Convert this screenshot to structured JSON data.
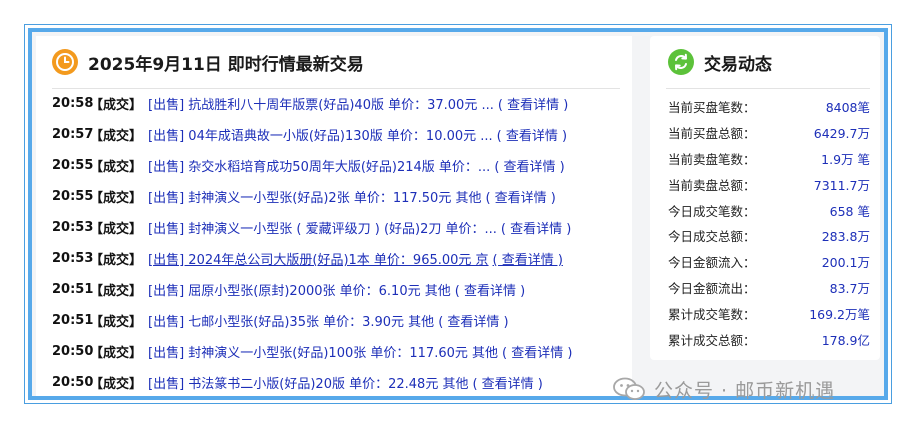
{
  "left_panel": {
    "title": "2025年9月11日 即时行情最新交易",
    "trades": [
      {
        "time": "20:58",
        "status": "【成交】",
        "desc": "[出售] 抗战胜利八十周年版票(好品)40版 单价：37.00元 ...",
        "detail": "( 查看详情 )"
      },
      {
        "time": "20:57",
        "status": "【成交】",
        "desc": "[出售] 04年成语典故一小版(好品)130版 单价：10.00元 ...",
        "detail": "( 查看详情 )"
      },
      {
        "time": "20:55",
        "status": "【成交】",
        "desc": "[出售] 杂交水稻培育成功50周年大版(好品)214版 单价：...",
        "detail": "( 查看详情 )"
      },
      {
        "time": "20:55",
        "status": "【成交】",
        "desc": "[出售] 封神演义一小型张(好品)2张 单价：117.50元 其他",
        "detail": "( 查看详情 )"
      },
      {
        "time": "20:53",
        "status": "【成交】",
        "desc": "[出售] 封神演义一小型张 ( 爱藏评级刀 ) (好品)2刀 单价：...",
        "detail": "( 查看详情 )"
      },
      {
        "time": "20:53",
        "status": "【成交】",
        "desc": "[出售] 2024年总公司大版册(好品)1本 单价：965.00元 京",
        "detail": "( 查看详情 )"
      },
      {
        "time": "20:51",
        "status": "【成交】",
        "desc": "[出售] 屈原小型张(原封)2000张 单价：6.10元 其他",
        "detail": "( 查看详情 )"
      },
      {
        "time": "20:51",
        "status": "【成交】",
        "desc": "[出售] 七邮小型张(好品)35张 单价：3.90元 其他",
        "detail": "( 查看详情 )"
      },
      {
        "time": "20:50",
        "status": "【成交】",
        "desc": "[出售] 封神演义一小型张(好品)100张 单价：117.60元 其他",
        "detail": "( 查看详情 )"
      },
      {
        "time": "20:50",
        "status": "【成交】",
        "desc": "[出售] 书法篆书二小版(好品)20版 单价：22.48元 其他",
        "detail": "( 查看详情 )"
      }
    ]
  },
  "right_panel": {
    "title": "交易动态",
    "stats": [
      {
        "label": "当前买盘笔数：",
        "value": "8408笔"
      },
      {
        "label": "当前买盘总额：",
        "value": "6429.7万"
      },
      {
        "label": "当前卖盘笔数：",
        "value": "1.9万 笔"
      },
      {
        "label": "当前卖盘总额：",
        "value": "7311.7万"
      },
      {
        "label": "今日成交笔数：",
        "value": "658 笔"
      },
      {
        "label": "今日成交总额：",
        "value": "283.8万"
      },
      {
        "label": "今日金额流入：",
        "value": "200.1万"
      },
      {
        "label": "今日金额流出：",
        "value": "83.7万"
      },
      {
        "label": "累计成交笔数：",
        "value": "169.2万笔"
      },
      {
        "label": "累计成交总额：",
        "value": "178.9亿"
      }
    ]
  },
  "watermark": {
    "text": "公众号 · 邮币新机遇"
  },
  "colors": {
    "frame_border": "#57a9ea",
    "link_blue": "#1d2fb8",
    "clock_orange": "#f39a1e",
    "swap_green": "#5cc23a"
  },
  "icons": {
    "left_header": "clock-icon",
    "right_header": "swap-arrows-icon",
    "watermark": "wechat-icon"
  }
}
